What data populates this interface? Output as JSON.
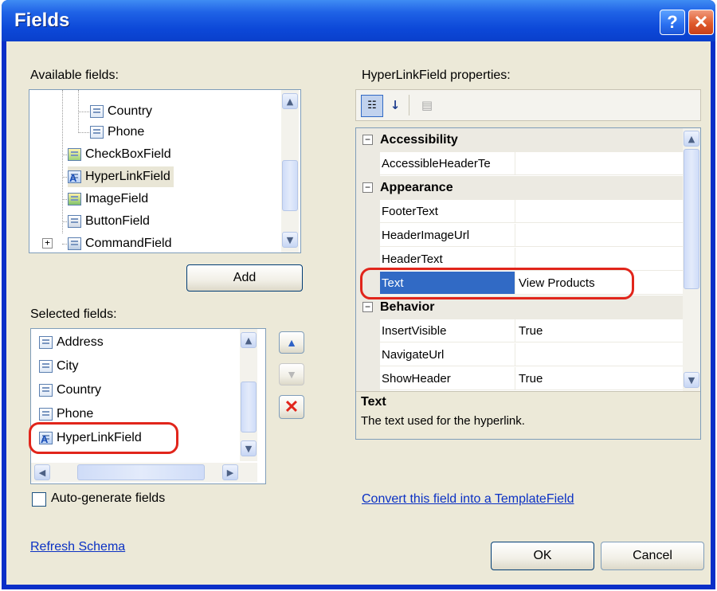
{
  "window": {
    "title": "Fields",
    "help_label": "?",
    "close_label": "✕"
  },
  "available": {
    "label": "Available fields:",
    "items": [
      {
        "label": "Country",
        "icon": "boundfield-icon"
      },
      {
        "label": "Phone",
        "icon": "boundfield-icon"
      },
      {
        "label": "CheckBoxField",
        "icon": "checkboxfield-icon"
      },
      {
        "label": "HyperLinkField",
        "icon": "hyperlinkfield-icon"
      },
      {
        "label": "ImageField",
        "icon": "imagefield-icon"
      },
      {
        "label": "ButtonField",
        "icon": "buttonfield-icon"
      },
      {
        "label": "CommandField",
        "icon": "commandfield-icon"
      }
    ],
    "expander": "+"
  },
  "add_button": {
    "label": "Add"
  },
  "selected": {
    "label": "Selected fields:",
    "items": [
      {
        "label": "Address"
      },
      {
        "label": "City"
      },
      {
        "label": "Country"
      },
      {
        "label": "Phone"
      },
      {
        "label": "HyperLinkField"
      }
    ]
  },
  "auto_generate": {
    "label": "Auto-generate fields",
    "checked": false
  },
  "refresh_link": "Refresh Schema",
  "properties": {
    "label": "HyperLinkField properties:",
    "categories": [
      {
        "name": "Accessibility",
        "sign": "⊟",
        "rows": [
          {
            "name": "AccessibleHeaderTe",
            "value": ""
          }
        ]
      },
      {
        "name": "Appearance",
        "sign": "⊟",
        "rows": [
          {
            "name": "FooterText",
            "value": ""
          },
          {
            "name": "HeaderImageUrl",
            "value": ""
          },
          {
            "name": "HeaderText",
            "value": ""
          },
          {
            "name": "Text",
            "value": "View Products"
          }
        ]
      },
      {
        "name": "Behavior",
        "sign": "⊟",
        "rows": [
          {
            "name": "InsertVisible",
            "value": "True"
          },
          {
            "name": "NavigateUrl",
            "value": ""
          },
          {
            "name": "ShowHeader",
            "value": "True"
          }
        ]
      }
    ],
    "description_title": "Text",
    "description_text": "The text used for the hyperlink."
  },
  "convert_link": "Convert this field into a TemplateField",
  "ok_button": "OK",
  "cancel_button": "Cancel",
  "colors": {
    "titlebar": "#0c48d8",
    "client": "#ece9d8",
    "highlight": "#e1251b",
    "selection": "#316ac5"
  }
}
